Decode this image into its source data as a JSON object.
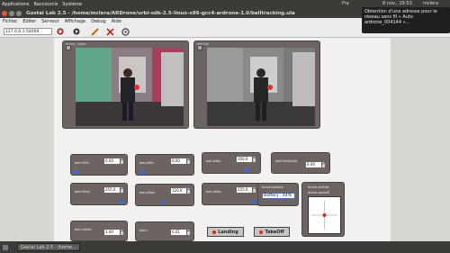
{
  "topbar": {
    "menus": [
      "Applications",
      "Raccourcis",
      "Système"
    ],
    "lang": "Fra",
    "datetime": "8 nov., 19:53",
    "user": "mclera"
  },
  "window": {
    "title": "Gostai Lab 2.5 - /home/mclera/ARDrone/urbi-sdk-2.5-linux-x86-gcc4-ardrone-1.0/balltracking.ula"
  },
  "notification": {
    "text": "Obtention d'une adresse pour le réseau sans fil « Auto ardrone_004144 »..."
  },
  "menubar": [
    "Fichier",
    "Editer",
    "Serveur",
    "Affichage",
    "Debug",
    "Aide"
  ],
  "toolbar": {
    "address": "127.0.0.1:54000"
  },
  "panels": {
    "left_title": "drone_.video",
    "right_title": "ball.tail"
  },
  "controls": [
    {
      "label": "ball.hMin",
      "value": "0.00"
    },
    {
      "label": "ball.pMin",
      "value": "0.00"
    },
    {
      "label": "ball.sMax",
      "value": "200.0"
    },
    {
      "label": "ball.threshold",
      "value": "0.00"
    },
    {
      "label": "ball.hMax",
      "value": "255.0"
    },
    {
      "label": "ball.pMax",
      "value": "120.0"
    },
    {
      "label": "ball.vMax",
      "value": "255.0"
    },
    {
      "label": "ball.visible",
      "value": "1.00"
    },
    {
      "label": "ball.x",
      "value": "0.01"
    }
  ],
  "battery": {
    "label": "drone.battery",
    "text": "Battery : 44%"
  },
  "joystick": {
    "labels": [
      "drone.shiftlat",
      "drone.speedZ"
    ]
  },
  "buttons": {
    "landing": "Landing",
    "takeoff": "TakeOff"
  },
  "taskbar": {
    "task": "Gostai Lab 2.5 - /home..."
  }
}
